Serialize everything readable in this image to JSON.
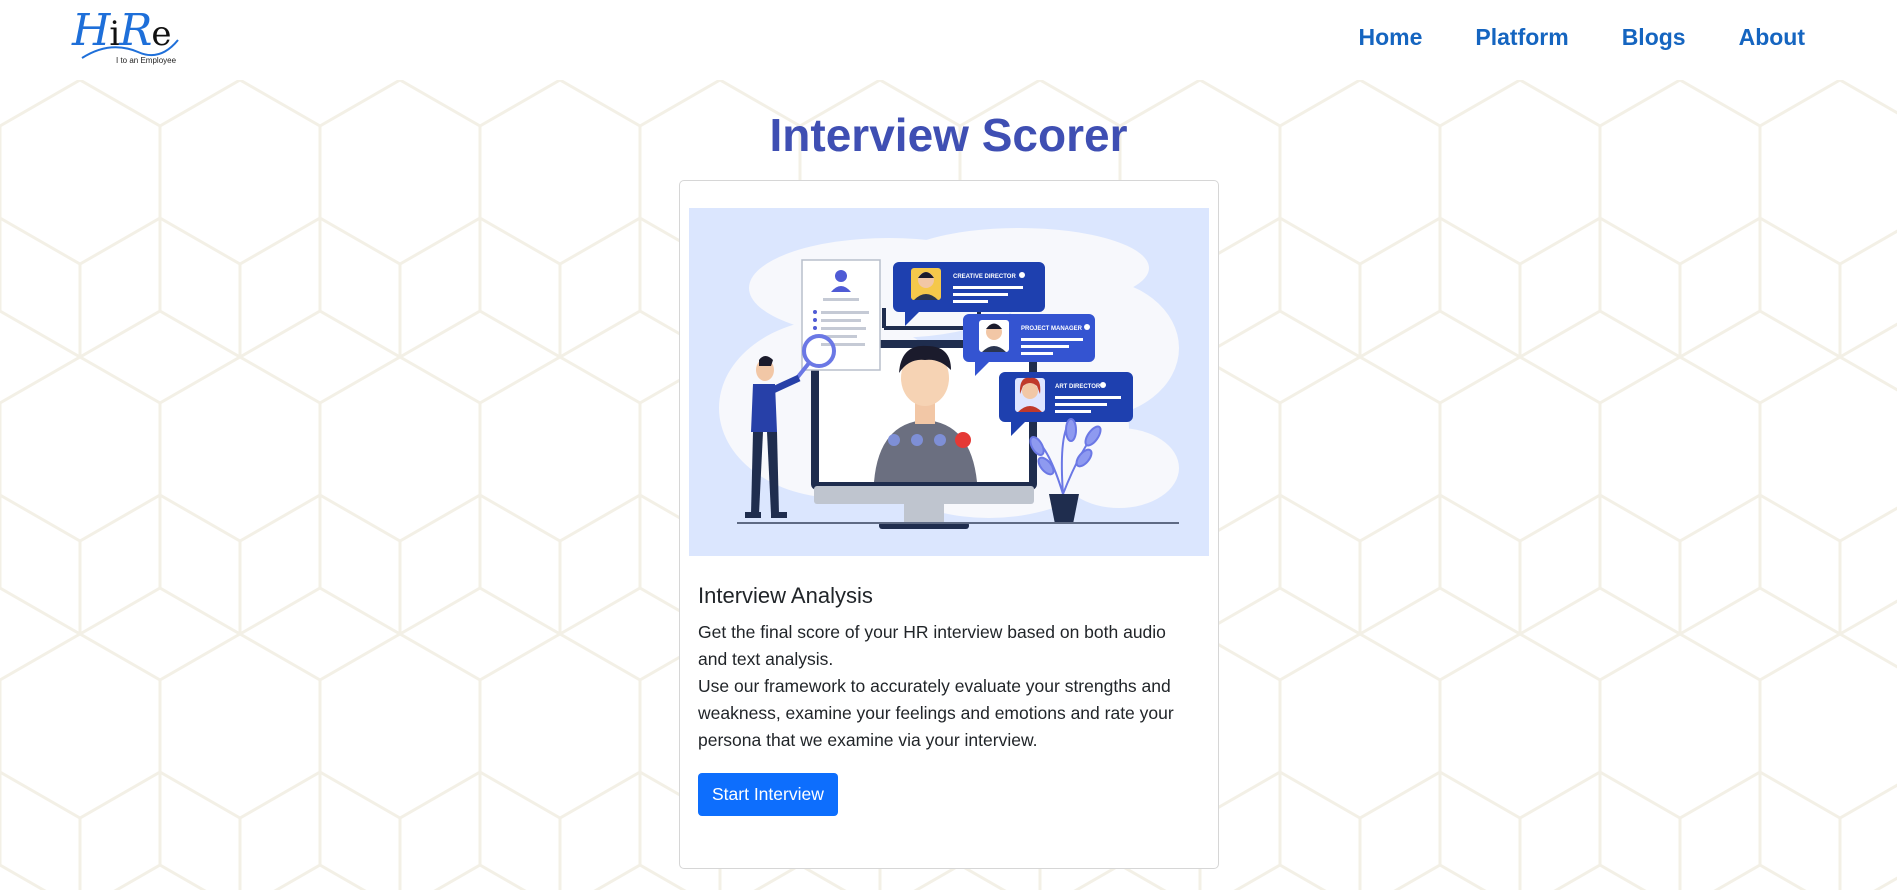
{
  "logo": {
    "letters": [
      "H",
      "i",
      "R",
      "e"
    ],
    "tagline": "I to an Employee"
  },
  "nav": {
    "items": [
      "Home",
      "Platform",
      "Blogs",
      "About"
    ]
  },
  "main": {
    "title": "Interview Scorer",
    "card": {
      "heading": "Interview Analysis",
      "line1": "Get the final score of your HR interview based on both audio and text analysis.",
      "line2": "Use our framework to accurately evaluate your strengths and weakness, examine your feelings and emotions and rate your persona that we examine via your interview.",
      "button": "Start Interview",
      "illustration": {
        "bubbles": [
          "CREATIVE DIRECTOR",
          "PROJECT MANAGER",
          "ART DIRECTOR"
        ]
      }
    }
  },
  "colors": {
    "nav_link": "#1565c0",
    "title": "#3f4fb3",
    "button": "#0d6efd",
    "illustration_bg": "#dbe6fe",
    "bubble": "#1e40af"
  }
}
